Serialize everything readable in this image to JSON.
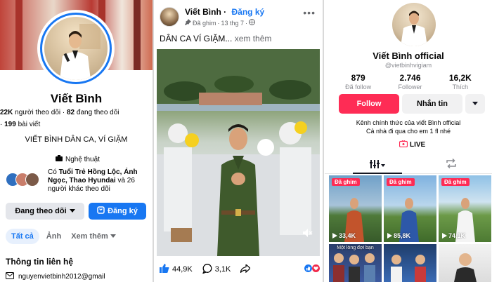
{
  "colors": {
    "fb_blue": "#1877f2",
    "tiktok_red": "#fe2c55",
    "muted": "#65676b"
  },
  "fb_profile": {
    "name": "Viết Bình",
    "followers": "22K",
    "followers_label": "người theo dõi",
    "following": "82",
    "following_label": "đang theo dõi",
    "posts": "199",
    "posts_label": "bài viết",
    "bio": "VIẾT BÌNH DÂN CA, VÍ GIẶM",
    "category": "Nghệ thuật",
    "mutual_prefix": "Có ",
    "mutual_names": "Tuổi Trẻ Hồng Lộc, Ánh Ngọc, Thao Hyundai",
    "mutual_suffix": " và 26 người khác theo dõi",
    "following_button": "Đang theo dõi",
    "register_button": "Đăng ký",
    "tabs": [
      "Tất cả",
      "Ảnh",
      "Xem thêm"
    ],
    "contact_heading": "Thông tin liên hệ",
    "email": "nguyenvietbinh2012@gmail"
  },
  "fb_post": {
    "author": "Viết Bình",
    "register_link": "Đăng ký",
    "pinned_label": "Đã ghim",
    "date": "13 thg 7",
    "caption": "DÂN CA VÍ GIẶM...",
    "see_more": "xem thêm",
    "likes": "44,9K",
    "comments": "3,1K"
  },
  "tiktok": {
    "name": "Viết Bình official",
    "handle": "@vietbinhvigiam",
    "stats": [
      {
        "value": "879",
        "label": "Đã follow"
      },
      {
        "value": "2.746",
        "label": "Follower"
      },
      {
        "value": "16,2K",
        "label": "Thích"
      }
    ],
    "follow_button": "Follow",
    "message_button": "Nhắn tin",
    "bio_line1": "Kênh chính thức của viết Bình official",
    "bio_line2": "Cả nhà đi qua cho em 1 fl nhé",
    "live": "LIVE",
    "pinned_label": "Đã ghim",
    "videos": [
      {
        "views": "33,4K",
        "pinned": true
      },
      {
        "views": "85,8K",
        "pinned": true
      },
      {
        "views": "74,1K",
        "pinned": true
      },
      {
        "views": "",
        "pinned": false,
        "caption": "Một lòng đợi bạn"
      },
      {
        "views": "",
        "pinned": false
      },
      {
        "views": "",
        "pinned": false
      }
    ]
  }
}
